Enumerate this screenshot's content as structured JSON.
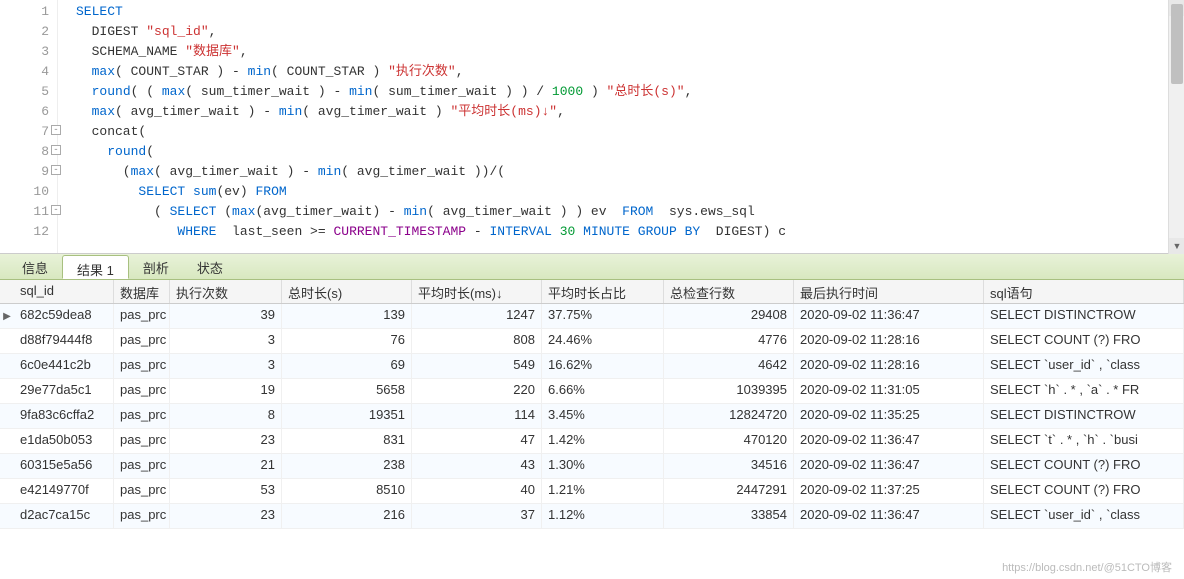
{
  "editor": {
    "lines": [
      {
        "n": 1,
        "fold": false,
        "html": "<span class='kw'>SELECT</span>"
      },
      {
        "n": 2,
        "fold": false,
        "html": "  DIGEST <span class='str'>\"sql_id\"</span>,"
      },
      {
        "n": 3,
        "fold": false,
        "html": "  SCHEMA_NAME <span class='str'>\"数据库\"</span>,"
      },
      {
        "n": 4,
        "fold": false,
        "html": "  <span class='kw'>max</span>( COUNT_STAR ) - <span class='kw'>min</span>( COUNT_STAR ) <span class='str'>\"执行次数\"</span>,"
      },
      {
        "n": 5,
        "fold": false,
        "html": "  <span class='kw'>round</span>( ( <span class='kw'>max</span>( sum_timer_wait ) - <span class='kw'>min</span>( sum_timer_wait ) ) / <span class='num'>1000</span> ) <span class='str'>\"总时长(s)\"</span>,"
      },
      {
        "n": 6,
        "fold": false,
        "html": "  <span class='kw'>max</span>( avg_timer_wait ) - <span class='kw'>min</span>( avg_timer_wait ) <span class='str'>\"平均时长(ms)↓\"</span>,"
      },
      {
        "n": 7,
        "fold": true,
        "html": "  concat("
      },
      {
        "n": 8,
        "fold": true,
        "html": "    <span class='kw'>round</span>("
      },
      {
        "n": 9,
        "fold": true,
        "html": "      (<span class='kw'>max</span>( avg_timer_wait ) - <span class='kw'>min</span>( avg_timer_wait ))/("
      },
      {
        "n": 10,
        "fold": false,
        "html": "        <span class='kw'>SELECT</span> <span class='kw'>sum</span>(ev) <span class='kw'>FROM</span>"
      },
      {
        "n": 11,
        "fold": true,
        "html": "          ( <span class='kw'>SELECT</span> (<span class='kw'>max</span>(avg_timer_wait) - <span class='kw'>min</span>( avg_timer_wait ) ) ev  <span class='kw'>FROM</span>  sys.ews_sql"
      },
      {
        "n": 12,
        "fold": false,
        "html": "             <span class='kw'>WHERE</span>  last_seen &gt;= <span class='purple'>CURRENT_TIMESTAMP</span> - <span class='kw'>INTERVAL</span> <span class='num'>30</span> <span class='kw'>MINUTE</span> <span class='kw'>GROUP BY</span>  DIGEST) c"
      }
    ]
  },
  "tabs": {
    "items": [
      "信息",
      "结果 1",
      "剖析",
      "状态"
    ],
    "active": 1
  },
  "grid": {
    "columns": [
      "sql_id",
      "数据库",
      "执行次数",
      "总时长(s)",
      "平均时长(ms)↓",
      "平均时长占比",
      "总检查行数",
      "最后执行时间",
      "sql语句"
    ],
    "rows": [
      {
        "sql_id": "682c59dea8",
        "db": "pas_prc",
        "exec": "39",
        "total": "139",
        "avg": "1247",
        "pct": "37.75%",
        "rows": "29408",
        "time": "2020-09-02 11:36:47",
        "sql": "SELECT DISTINCTROW"
      },
      {
        "sql_id": "d88f79444f8",
        "db": "pas_prc",
        "exec": "3",
        "total": "76",
        "avg": "808",
        "pct": "24.46%",
        "rows": "4776",
        "time": "2020-09-02 11:28:16",
        "sql": "SELECT COUNT (?) FRO"
      },
      {
        "sql_id": "6c0e441c2b",
        "db": "pas_prc",
        "exec": "3",
        "total": "69",
        "avg": "549",
        "pct": "16.62%",
        "rows": "4642",
        "time": "2020-09-02 11:28:16",
        "sql": "SELECT `user_id` , `class"
      },
      {
        "sql_id": "29e77da5c1",
        "db": "pas_prc",
        "exec": "19",
        "total": "5658",
        "avg": "220",
        "pct": "6.66%",
        "rows": "1039395",
        "time": "2020-09-02 11:31:05",
        "sql": "SELECT `h` . * , `a` . * FR"
      },
      {
        "sql_id": "9fa83c6cffa2",
        "db": "pas_prc",
        "exec": "8",
        "total": "19351",
        "avg": "114",
        "pct": "3.45%",
        "rows": "12824720",
        "time": "2020-09-02 11:35:25",
        "sql": "SELECT DISTINCTROW"
      },
      {
        "sql_id": "e1da50b053",
        "db": "pas_prc",
        "exec": "23",
        "total": "831",
        "avg": "47",
        "pct": "1.42%",
        "rows": "470120",
        "time": "2020-09-02 11:36:47",
        "sql": "SELECT `t` . * , `h` . `busi"
      },
      {
        "sql_id": "60315e5a56",
        "db": "pas_prc",
        "exec": "21",
        "total": "238",
        "avg": "43",
        "pct": "1.30%",
        "rows": "34516",
        "time": "2020-09-02 11:36:47",
        "sql": "SELECT COUNT (?) FRO"
      },
      {
        "sql_id": "e42149770f",
        "db": "pas_prc",
        "exec": "53",
        "total": "8510",
        "avg": "40",
        "pct": "1.21%",
        "rows": "2447291",
        "time": "2020-09-02 11:37:25",
        "sql": "SELECT COUNT (?) FRO"
      },
      {
        "sql_id": "d2ac7ca15c",
        "db": "pas_prc",
        "exec": "23",
        "total": "216",
        "avg": "37",
        "pct": "1.12%",
        "rows": "33854",
        "time": "2020-09-02 11:36:47",
        "sql": "SELECT `user_id` , `class"
      }
    ]
  },
  "watermark": "https://blog.csdn.net/@51CTO博客"
}
